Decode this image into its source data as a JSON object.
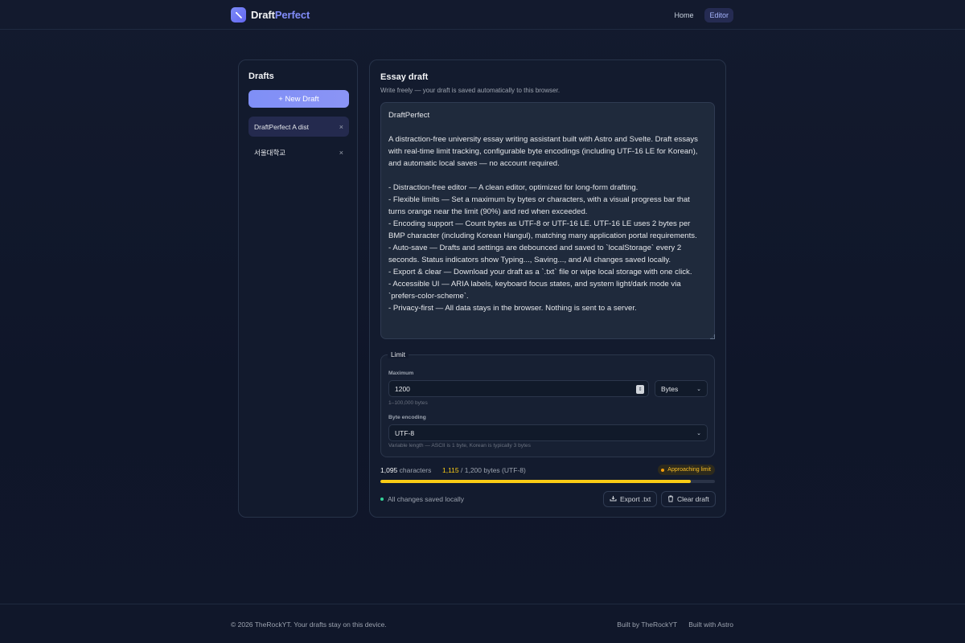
{
  "brand": {
    "name_part1": "Draft",
    "name_part2": "Perfect"
  },
  "nav": {
    "home": "Home",
    "editor": "Editor"
  },
  "sidebar": {
    "title": "Drafts",
    "new_draft_label": "+ New Draft",
    "drafts": [
      {
        "title": "DraftPerfect A dist",
        "close": "×"
      },
      {
        "title": "서울대학교",
        "close": "×"
      }
    ]
  },
  "main": {
    "title": "Essay draft",
    "subtitle": "Write freely — your draft is saved automatically to this browser.",
    "editor_text": "DraftPerfect\n\nA distraction-free university essay writing assistant built with Astro and Svelte. Draft essays with real-time limit tracking, configurable byte encodings (including UTF-16 LE for Korean), and automatic local saves — no account required.\n\n- Distraction-free editor — A clean editor, optimized for long-form drafting.\n- Flexible limits — Set a maximum by bytes or characters, with a visual progress bar that turns orange near the limit (90%) and red when exceeded.\n- Encoding support — Count bytes as UTF-8 or UTF-16 LE. UTF-16 LE uses 2 bytes per BMP character (including Korean Hangul), matching many application portal requirements.\n- Auto-save — Drafts and settings are debounced and saved to `localStorage` every 2 seconds. Status indicators show Typing..., Saving..., and All changes saved locally.\n- Export & clear — Download your draft as a `.txt` file or wipe local storage with one click.\n- Accessible UI — ARIA labels, keyboard focus states, and system light/dark mode via `prefers-color-scheme`.\n- Privacy-first — All data stays in the browser. Nothing is sent to a server."
  },
  "limit": {
    "legend": "Limit",
    "maximum_label": "Maximum",
    "maximum_value": "1200",
    "maximum_hint": "1–100,000 bytes",
    "unit_value": "Bytes",
    "encoding_label": "Byte encoding",
    "encoding_value": "UTF-8",
    "encoding_hint": "Variable length — ASCII is 1 byte, Korean is typically 3 bytes"
  },
  "stats": {
    "char_count": "1,095",
    "char_label": "characters",
    "byte_count": "1,115",
    "byte_rest": "/ 1,200 bytes (UTF-8)",
    "badge": "Approaching limit",
    "progress_fraction": 0.929
  },
  "status": {
    "save_text": "All changes saved locally"
  },
  "actions": {
    "export": "Export .txt",
    "clear": "Clear draft"
  },
  "footer": {
    "copyright": "© 2026 TheRockYT. Your drafts stay on this device.",
    "built_by": "Built by TheRockYT",
    "built_with": "Built with Astro"
  },
  "colors": {
    "accent": "#818cf8",
    "warning": "#facc15",
    "success": "#34d399"
  }
}
